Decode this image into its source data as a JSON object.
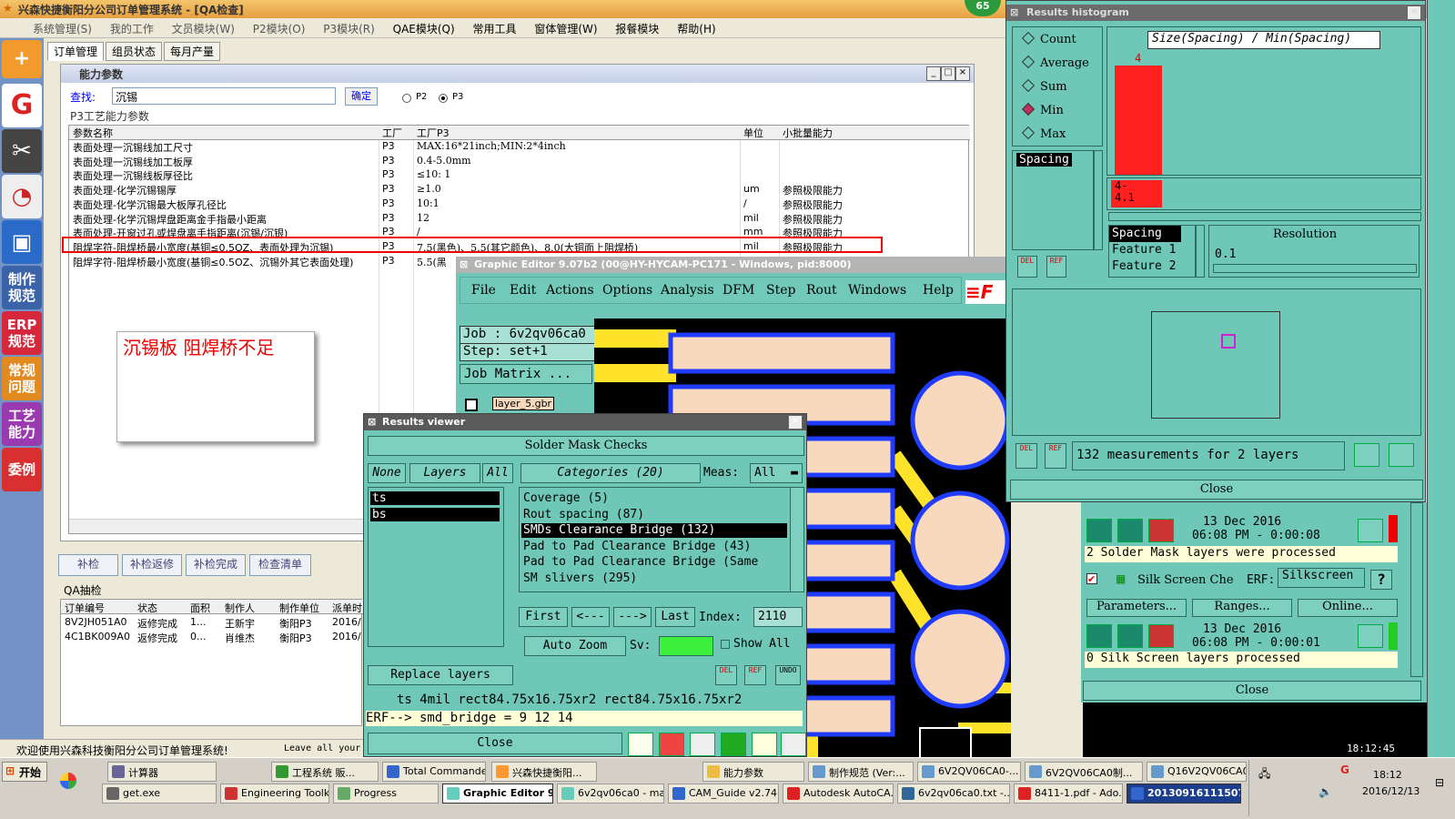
{
  "erp": {
    "title": "兴森快捷衡阳分公司订单管理系统 - [QA检查]",
    "badge": "65",
    "menu": [
      "系统管理(S)",
      "我的工作",
      "文员模块(W)",
      "P2模块(O)",
      "P3模块(R)",
      "QAE模块(Q)",
      "常用工具",
      "窗体管理(W)",
      "报餐模块",
      "帮助(H)"
    ],
    "tabs": [
      "订单管理",
      "组员状态",
      "每月产量"
    ],
    "sidebar": [
      "制作规范",
      "ERP规范",
      "常规问题",
      "工艺能力",
      "委例"
    ],
    "params_title": "能力参数",
    "search_label": "查找:",
    "search_value": "沉锡",
    "confirm": "确定",
    "radio_p2": "P2",
    "radio_p3": "P3",
    "group_label": "P3工艺能力参数",
    "columns": [
      "参数名称",
      "工厂",
      "工厂P3",
      "单位",
      "小批量能力"
    ],
    "rows": [
      [
        "表面处理一沉锡线加工尺寸",
        "P3",
        "MAX:16*21inch;MIN:2*4inch",
        "",
        ""
      ],
      [
        "表面处理一沉锡线加工板厚",
        "P3",
        "0.4-5.0mm",
        "",
        ""
      ],
      [
        "表面处理一沉锡线板厚径比",
        "P3",
        "≤10: 1",
        "",
        ""
      ],
      [
        "表面处理-化学沉锡锡厚",
        "P3",
        "≥1.0",
        "um",
        "参照极限能力"
      ],
      [
        "表面处理-化学沉锡最大板厚孔径比",
        "P3",
        "10:1",
        "/",
        "参照极限能力"
      ],
      [
        "表面处理-化学沉锡焊盘距离金手指最小距离",
        "P3",
        "12",
        "mil",
        "参照极限能力"
      ],
      [
        "表面处理-开窗过孔或焊盘离手指距离(沉锡/沉银)",
        "P3",
        "/",
        "mm",
        "参照极限能力"
      ],
      [
        "阻焊字符-阻焊桥最小宽度(基铜≤0.5OZ、表面处理为沉锡)",
        "P3",
        "7.5(黑色)、5.5(其它颜色)、8.0(大铜面上阻焊桥)",
        "mil",
        "参照极限能力"
      ],
      [
        "阻焊字符-阻焊桥最小宽度(基铜≤0.5OZ、沉锡外其它表面处理)",
        "P3",
        "5.5(黑",
        "",
        ""
      ]
    ],
    "note": "沉锡板    阻焊桥不足",
    "buttons": [
      "补检",
      "补检返修",
      "补检完成",
      "检查清单"
    ],
    "qa_label": "QA抽检",
    "qa_columns": [
      "订单编号",
      "状态",
      "面积",
      "制作人",
      "制作单位",
      "派单时"
    ],
    "qa_rows": [
      [
        "8V2JH051A0",
        "返修完成",
        "1...",
        "王新宇",
        "衡阳P3",
        "2016/"
      ],
      [
        "4C1BK009A0",
        "返修完成",
        "0...",
        "肖维杰",
        "衡阳P3",
        "2016/"
      ]
    ],
    "status": "欢迎使用兴森科技衡阳分公司订单管理系统!",
    "status_right": "Leave all your"
  },
  "editor": {
    "title": "Graphic Editor 9.07b2 (00@HY-HYCAM-PC171 - Windows, pid:8000)",
    "menu": [
      "File",
      "Edit",
      "Actions",
      "Options",
      "Analysis",
      "DFM",
      "Step",
      "Rout",
      "Windows",
      "Help"
    ],
    "job": "Job : 6v2qv06ca0",
    "step": "Step: set+1",
    "job_matrix": "Job Matrix ...",
    "layer": "layer_5.gbr"
  },
  "results": {
    "title": "Results viewer",
    "heading": "Solder Mask Checks",
    "none": "None",
    "layers": "Layers",
    "all": "All",
    "categories": "Categories (20)",
    "meas_label": "Meas:",
    "meas_value": "All",
    "layer_items": [
      "ts",
      "bs"
    ],
    "category_items": [
      "Coverage (5)",
      "Rout spacing (87)",
      "SMDs Clearance Bridge (132)",
      "Pad to Pad Clearance Bridge (43)",
      "Pad to Pad Clearance Bridge (Same",
      "SM slivers (295)"
    ],
    "first": "First",
    "prev": "<---",
    "next": "--->",
    "last": "Last",
    "index_label": "Index:",
    "index_value": "2110",
    "auto_zoom": "Auto Zoom",
    "sv": "Sv:",
    "show_all": "Show All",
    "replace_layers": "Replace layers",
    "del": "DEL",
    "ref": "REF",
    "undo": "UNDO",
    "measure_line": "ts 4mil  rect84.75x16.75xr2  rect84.75x16.75xr2",
    "erf_line": "ERF--> smd_bridge = 9 12 14",
    "close": "Close"
  },
  "histogram": {
    "title": "Results histogram",
    "options": [
      "Count",
      "Average",
      "Sum",
      "Min",
      "Max"
    ],
    "selected": "Min",
    "chart_title": "Size(Spacing) / Min(Spacing)",
    "bar_label": "4",
    "range_label": "4-",
    "range_label2": "4.1",
    "list_item": "Spacing",
    "feature_items": [
      "Spacing",
      "Feature 1",
      "Feature 2"
    ],
    "resolution_label": "Resolution",
    "resolution_value": "0.1",
    "measurements": "132 measurements for 2 layers",
    "close": "Close"
  },
  "checks_panel": {
    "date1": "13 Dec 2016",
    "time1": "06:08 PM - 0:00:08",
    "msg1": "2 Solder Mask layers were processed",
    "silk_label": "Silk Screen Che",
    "erf_label": "ERF:",
    "erf_value": "Silkscreen",
    "q": "?",
    "parameters": "Parameters...",
    "ranges": "Ranges...",
    "online": "Online...",
    "date2": "13 Dec 2016",
    "time2": "06:08 PM - 0:00:01",
    "msg2": "0 Silk Screen layers processed",
    "close": "Close"
  },
  "taskbar": {
    "start": "开始",
    "row1": [
      "计算器",
      "工程系统  販...",
      "Total Comma​nde...",
      "兴森快捷衡阳...",
      "能力参数",
      "制作规范 (Ver:...",
      "6V2QV06CA0-...",
      "6V2QV06CA0制...",
      "Q16V2QV06CA0..."
    ],
    "row2": [
      "get.exe",
      "Engineering Toolki...",
      "Progress",
      "Graphic Editor 9....",
      "6v2qv06ca0 - mai...",
      "CAM_Guide v2.74",
      "Autodesk AutoCA...",
      "6v2qv06ca0.txt -...",
      "8411-1.pdf - Ado...",
      "20130916111507..."
    ],
    "clock_time": "18:12",
    "clock_date": "2016/12/13",
    "small_time": "18:12:45"
  },
  "colors": {
    "cam_teal": "#6fc7b8",
    "pad_fill": "#f9d9bd",
    "pad_border": "#1f3cff",
    "trace_yellow": "#ffe22a",
    "hist_bar": "#ff2020",
    "highlight": "#e00000"
  }
}
